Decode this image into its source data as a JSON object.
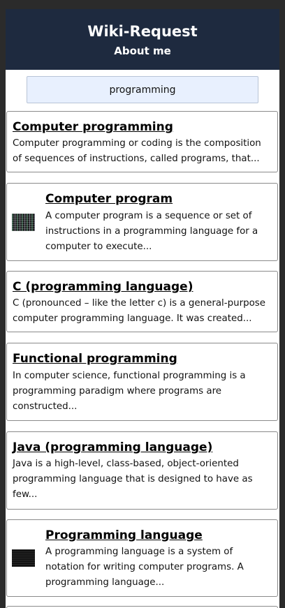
{
  "header": {
    "title": "Wiki-Request",
    "subtitle": "About me"
  },
  "search": {
    "value": "programming"
  },
  "results": [
    {
      "title": "Computer programming",
      "description": "Computer programming or coding is the composition of sequences of instructions, called programs, that..."
    },
    {
      "title": "Computer program",
      "description": "A computer program is a sequence or set of instructions in a programming language for a computer to execute...",
      "thumbnail": "code-screenshot-thumbnail"
    },
    {
      "title": "C (programming language)",
      "description": "C (pronounced – like the letter c) is a general-purpose computer programming language. It was created..."
    },
    {
      "title": "Functional programming",
      "description": "In computer science, functional programming is a programming paradigm where programs are constructed..."
    },
    {
      "title": "Java (programming language)",
      "description": "Java is a high-level, class-based, object-oriented programming language that is designed to have as few..."
    },
    {
      "title": "Programming language",
      "description": "A programming language is a system of notation for writing computer programs. A programming language...",
      "thumbnail": "dark-code-thumbnail"
    }
  ]
}
